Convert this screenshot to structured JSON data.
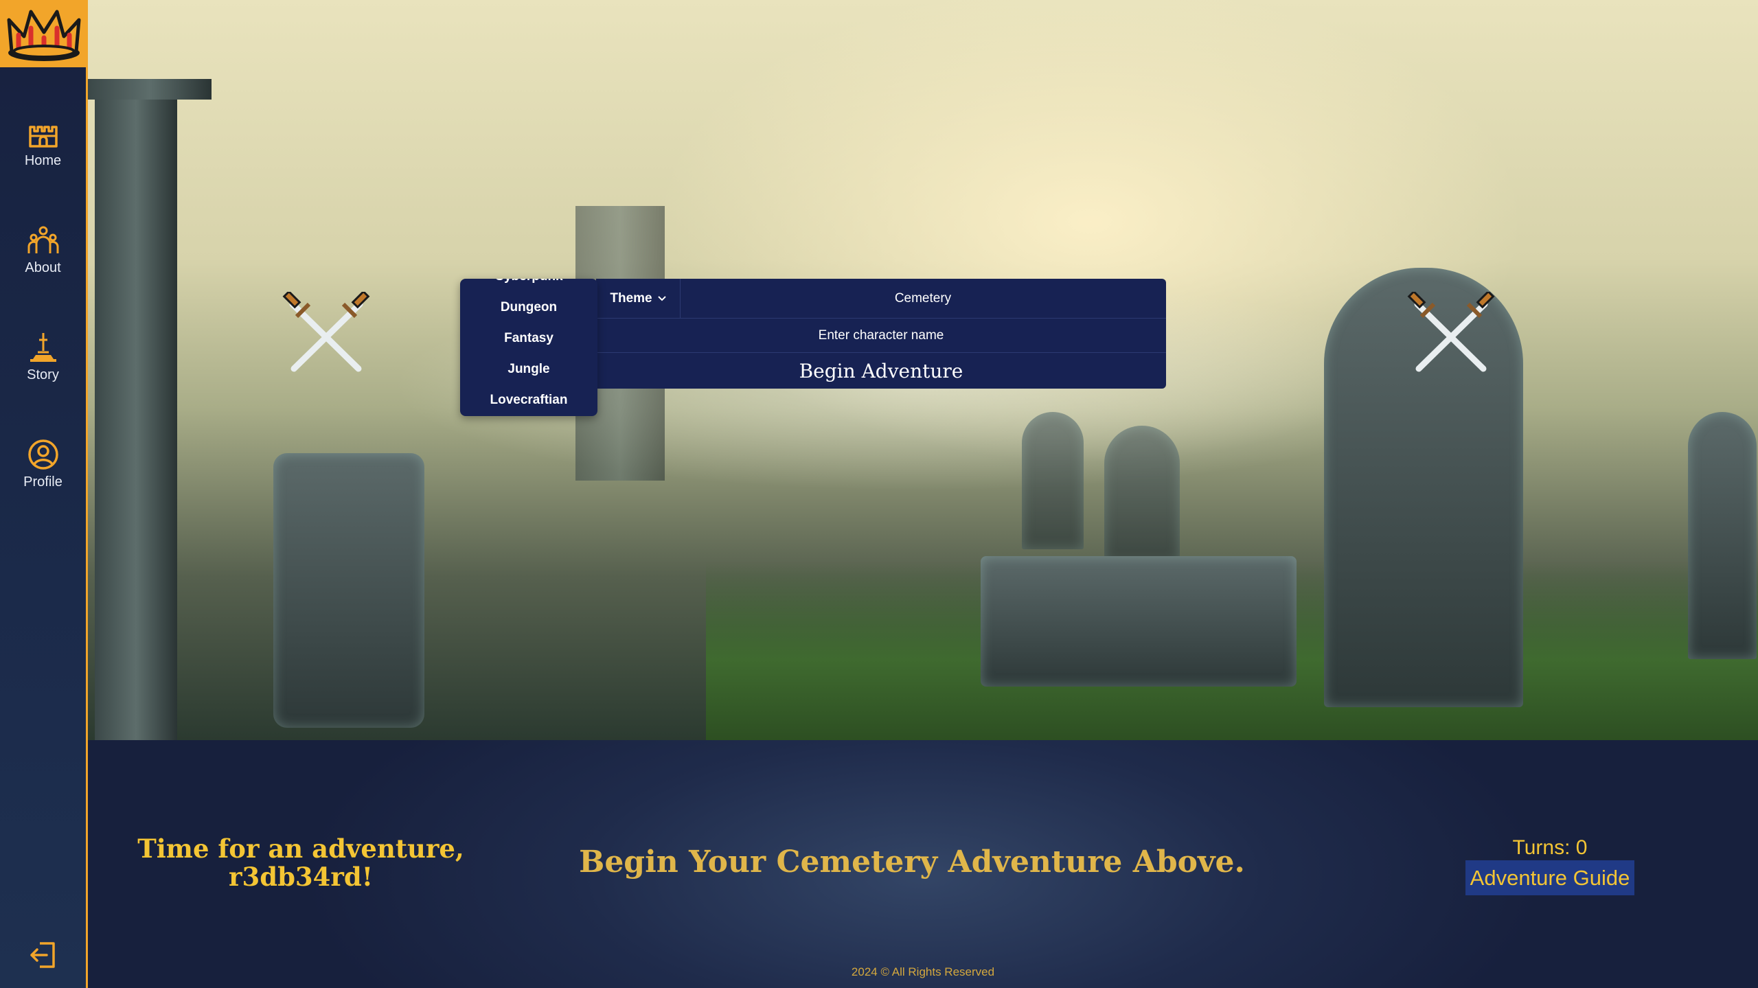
{
  "sidebar": {
    "logo": "crown-logo",
    "items": [
      {
        "label": "Home",
        "icon": "castle-icon"
      },
      {
        "label": "About",
        "icon": "people-icon"
      },
      {
        "label": "Story",
        "icon": "sword-stand-icon"
      },
      {
        "label": "Profile",
        "icon": "user-circle-icon"
      }
    ],
    "logout_icon": "logout-icon"
  },
  "theme_menu": {
    "options": [
      "Cyberpunk",
      "Dungeon",
      "Fantasy",
      "Jungle",
      "Lovecraftian"
    ]
  },
  "form": {
    "theme_label": "Theme",
    "theme_value": "Cemetery",
    "name_placeholder": "Enter character name",
    "begin_label": "Begin Adventure"
  },
  "bottom": {
    "greeting": "Time for an adventure, r3db34rd!",
    "headline": "Begin Your Cemetery Adventure Above.",
    "turns": "Turns: 0",
    "guide_label": "Adventure Guide",
    "footer": "2024 © All Rights Reserved"
  },
  "colors": {
    "accent": "#f2a52a",
    "gold_text": "#f4c534",
    "panel": "#172253",
    "sidebar": "#1b2a4a"
  }
}
